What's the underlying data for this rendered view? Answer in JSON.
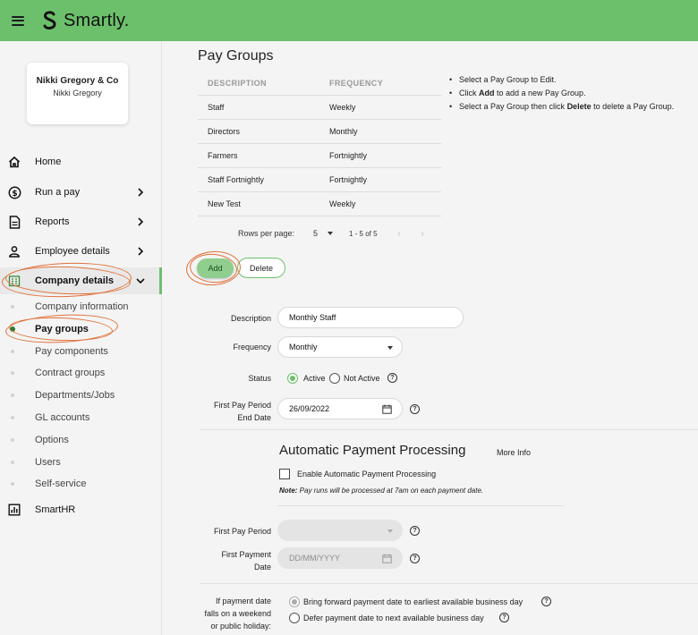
{
  "app": {
    "brand": "Smartly."
  },
  "company": {
    "name": "Nikki Gregory & Co",
    "user": "Nikki Gregory"
  },
  "nav": {
    "home": "Home",
    "run_pay": "Run a pay",
    "reports": "Reports",
    "employee_details": "Employee details",
    "company_details": "Company details",
    "smarthr": "SmartHR"
  },
  "subnav": [
    "Company information",
    "Pay groups",
    "Pay components",
    "Contract groups",
    "Departments/Jobs",
    "GL accounts",
    "Options",
    "Users",
    "Self-service"
  ],
  "page": {
    "title": "Pay Groups"
  },
  "table": {
    "headers": [
      "DESCRIPTION",
      "FREQUENCY"
    ],
    "rows": [
      {
        "description": "Staff",
        "frequency": "Weekly"
      },
      {
        "description": "Directors",
        "frequency": "Monthly"
      },
      {
        "description": "Farmers",
        "frequency": "Fortnightly"
      },
      {
        "description": "Staff Fortnightly",
        "frequency": "Fortnightly"
      },
      {
        "description": "New Test",
        "frequency": "Weekly"
      }
    ]
  },
  "pager": {
    "rows_per_page_label": "Rows per page:",
    "rows_per_page": "5",
    "count": "1 - 5 of 5"
  },
  "help": {
    "line1": "Select a Pay Group to Edit.",
    "line2_pre": "Click ",
    "line2_bold": "Add",
    "line2_post": " to add a new Pay Group.",
    "line3_pre": "Select a Pay Group then click ",
    "line3_bold": "Delete",
    "line3_post": " to delete a Pay Group."
  },
  "buttons": {
    "add": "Add",
    "delete": "Delete"
  },
  "form": {
    "description_label": "Description",
    "description_value": "Monthly Staff",
    "frequency_label": "Frequency",
    "frequency_value": "Monthly",
    "status_label": "Status",
    "status_active": "Active",
    "status_inactive": "Not Active",
    "first_end_label_1": "First Pay Period",
    "first_end_label_2": "End Date",
    "first_end_value": "26/09/2022"
  },
  "auto": {
    "title": "Automatic Payment Processing",
    "more_info": "More Info",
    "enable_label": "Enable Automatic Payment Processing",
    "note_bold": "Note:",
    "note_text": " Pay runs will be processed at 7am on each payment date.",
    "first_period_label": "First Pay Period",
    "first_payment_label_1": "First Payment",
    "first_payment_label_2": "Date",
    "first_payment_placeholder": "DD/MM/YYYY",
    "weekend_label_1": "If payment date",
    "weekend_label_2": "falls on a weekend",
    "weekend_label_3": "or public holiday:",
    "option_forward": "Bring forward payment date to earliest available business day",
    "option_defer": "Defer payment date to next available business day"
  },
  "colors": {
    "brand_green": "#6cc06b",
    "annotation_orange": "#e0703a"
  }
}
